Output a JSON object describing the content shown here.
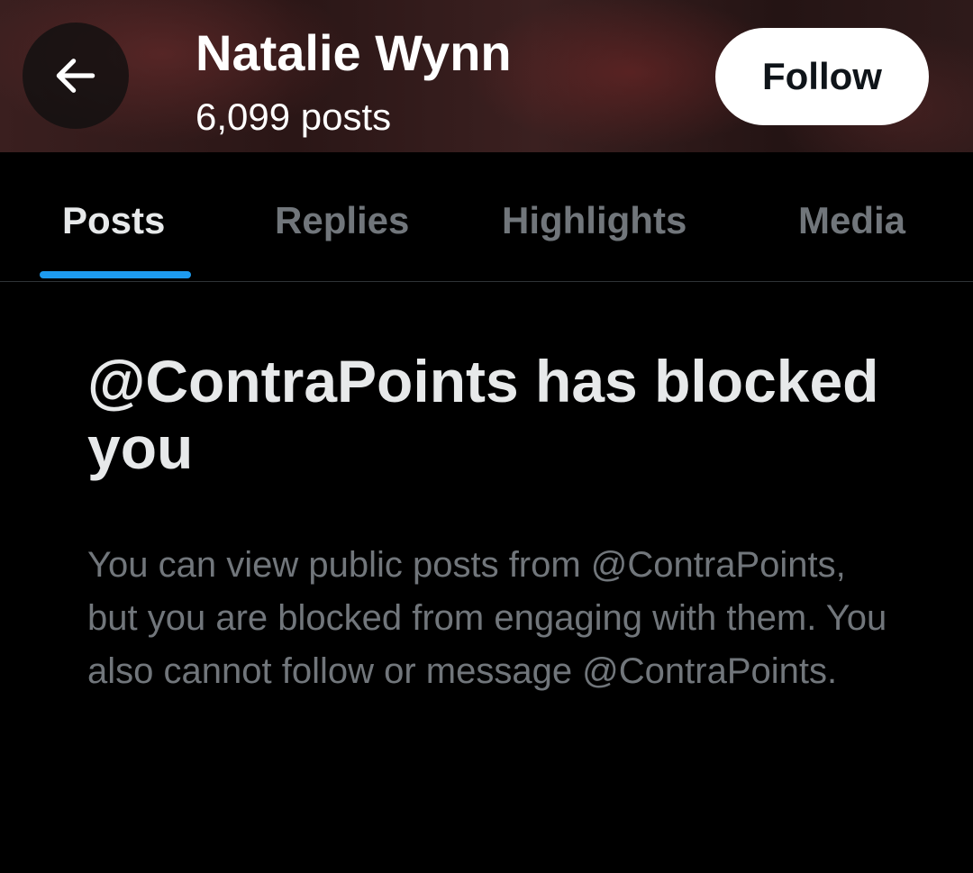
{
  "header": {
    "name": "Natalie Wynn",
    "post_count": "6,099 posts",
    "follow_label": "Follow"
  },
  "tabs": [
    {
      "label": "Posts",
      "active": true
    },
    {
      "label": "Replies",
      "active": false
    },
    {
      "label": "Highlights",
      "active": false
    },
    {
      "label": "Media",
      "active": false
    }
  ],
  "blocked": {
    "title": "@ContraPoints has blocked you",
    "message": "You can view public posts from @ContraPoints, but you are blocked from engaging with them. You also cannot follow or message @ContraPoints."
  },
  "icons": {
    "back": "arrow-left-icon"
  },
  "colors": {
    "accent": "#1d9bf0",
    "background": "#000000",
    "secondary_text": "#71767b",
    "primary_text": "#e7e9ea"
  }
}
